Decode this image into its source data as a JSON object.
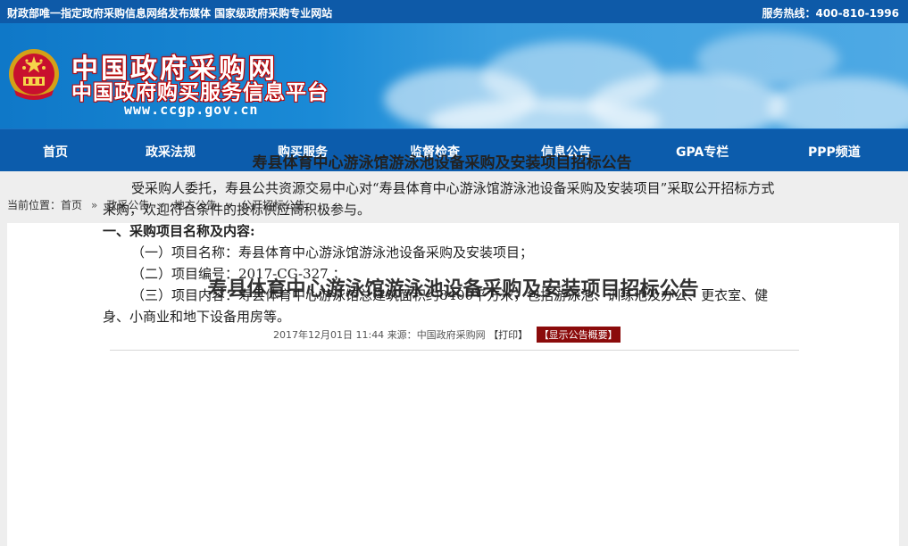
{
  "topbar": {
    "left_text": "财政部唯一指定政府采购信息网络发布媒体  国家级政府采购专业网站",
    "hotline": "服务热线：400-810-1996"
  },
  "banner": {
    "title": "中国政府采购网",
    "subtitle": "中国政府购买服务信息平台",
    "url": "www.ccgp.gov.cn"
  },
  "nav": {
    "items": [
      {
        "label": "首页"
      },
      {
        "label": "政采法规"
      },
      {
        "label": "购买服务"
      },
      {
        "label": "监督检查"
      },
      {
        "label": "信息公告"
      },
      {
        "label": "GPA专栏"
      },
      {
        "label": "PPP频道"
      }
    ]
  },
  "breadcrumb": {
    "prefix": "当前位置：",
    "items": [
      "首页",
      "政采公告",
      "地方公告",
      "公开招标公告"
    ],
    "separator": "»"
  },
  "notice": {
    "title": "寿县体育中心游泳馆游泳池设备采购及安装项目招标公告",
    "date": "2017年12月01日  11:44",
    "source_label": "来源：",
    "source": "中国政府采购网",
    "print_label": "【打印】",
    "summary_button": "【显示公告概要】"
  },
  "article": {
    "heading": "寿县体育中心游泳馆游泳池设备采购及安装项目招标公告",
    "intro": "受采购人委托，寿县公共资源交易中心对“寿县体育中心游泳馆游泳池设备采购及安装项目”采取公开招标方式采购，欢迎符合条件的投标供应商积极参与。",
    "section1": "一、采购项目名称及内容:",
    "item1": "（一）项目名称：寿县体育中心游泳馆游泳池设备采购及安装项目；",
    "item2": "（二）项目编号：2017-CG-327 ；",
    "item3": "（三）项目内容：寿县体育中心游泳馆总建筑面积约8400平方米，包括游泳池、训练池及办公、更衣室、健身、小商业和地下设备用房等。"
  }
}
